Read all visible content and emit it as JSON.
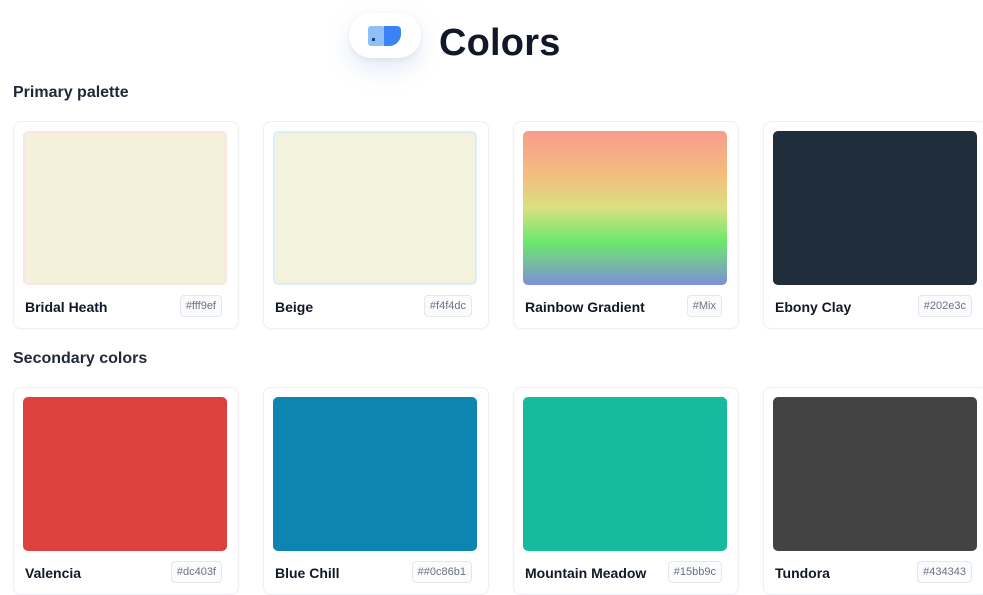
{
  "header": {
    "title": "Colors",
    "logo_icon": "palette-book-icon"
  },
  "sections": [
    {
      "title": "Primary palette",
      "colors": [
        {
          "name": "Bridal Heath",
          "code": "#fff9ef",
          "fill": "#f3f1da",
          "border": "#fde4e4"
        },
        {
          "name": "Beige",
          "code": "#f4f4dc",
          "fill": "#f3f2dc",
          "border": "#dceef8"
        },
        {
          "name": "Rainbow Gradient",
          "code": "#Mix",
          "fill": "linear-gradient(180deg,#f99c8e 0%,#f3bd7e 28%,#dbe080 50%,#6be86c 72%,#7f8fd8 100%)",
          "border": "transparent"
        },
        {
          "name": "Ebony Clay",
          "code": "#202e3c",
          "fill": "#202e3c",
          "border": "transparent"
        }
      ]
    },
    {
      "title": "Secondary colors",
      "colors": [
        {
          "name": "Valencia",
          "code": "#dc403f",
          "fill": "#dc403f",
          "border": "transparent"
        },
        {
          "name": "Blue Chill",
          "code": "##0c86b1",
          "fill": "#0c86b1",
          "border": "transparent"
        },
        {
          "name": "Mountain Meadow",
          "code": "#15bb9c",
          "fill": "#15bb9c",
          "border": "transparent"
        },
        {
          "name": "Tundora",
          "code": "#434343",
          "fill": "#434343",
          "border": "transparent"
        }
      ]
    }
  ]
}
